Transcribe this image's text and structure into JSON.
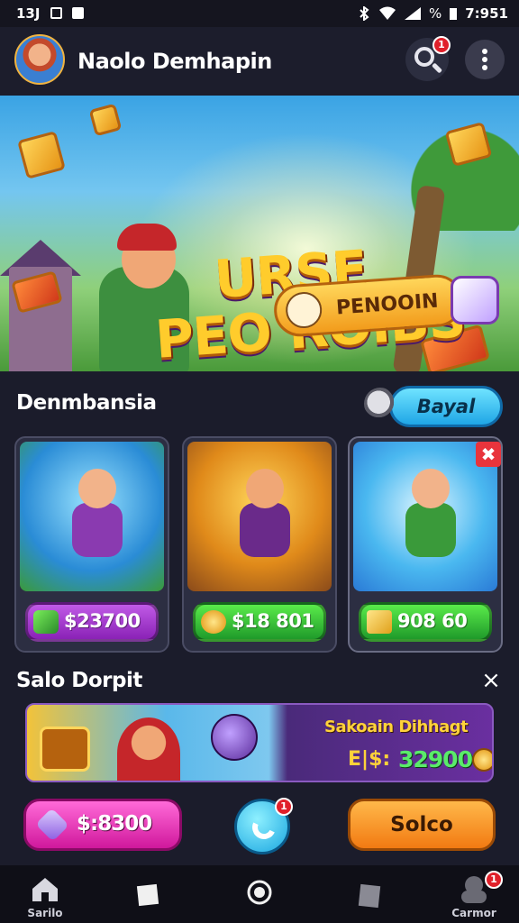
{
  "status_bar": {
    "time_left": "13J",
    "time_right": "7:951",
    "battery_text": "%"
  },
  "header": {
    "username": "Naolo Demhapin",
    "search_badge": "1"
  },
  "hero": {
    "title_line1": "URSE",
    "title_line2": "PEO ROIBS",
    "button_label": "PENOOIN"
  },
  "section1": {
    "title": "Denmbansia",
    "button_label": "Bayal",
    "cards": [
      {
        "price": "$23700"
      },
      {
        "price": "$18 801"
      },
      {
        "price": "908 60"
      }
    ],
    "card_close": "✖"
  },
  "section2": {
    "title": "Salo Dorpit",
    "close": "×",
    "promo_title": "Sakoain Dihhagt",
    "promo_prefix": "E|$:",
    "promo_value": "32900"
  },
  "actions": {
    "left_label": "$:8300",
    "phone_badge": "1",
    "right_label": "Solco"
  },
  "bottom_nav": {
    "items": [
      {
        "label": "Sarilo",
        "icon": "home-icon"
      },
      {
        "label": "",
        "icon": "square-icon"
      },
      {
        "label": "",
        "icon": "circle-home-icon"
      },
      {
        "label": "",
        "icon": "recent-icon"
      },
      {
        "label": "Carmor",
        "icon": "profile-icon",
        "badge": "1"
      }
    ]
  },
  "colors": {
    "background": "#1b1c2b",
    "green_price": "#3fc83a",
    "purple_price": "#a23ad0",
    "pink_button": "#e8309c",
    "orange_button": "#f58c1c",
    "blue_button": "#2ab4ee"
  }
}
